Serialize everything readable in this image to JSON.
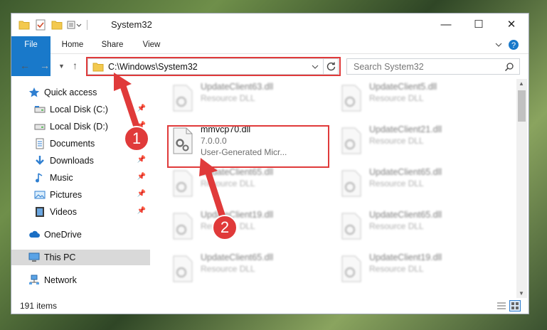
{
  "window": {
    "title": "System32",
    "controls": {
      "minimize": "—",
      "maximize": "☐",
      "close": "✕"
    }
  },
  "ribbon": {
    "tabs": [
      {
        "label": "File"
      },
      {
        "label": "Home"
      },
      {
        "label": "Share"
      },
      {
        "label": "View"
      }
    ],
    "expand_icon": "chevron-down-icon",
    "help_icon": "help-icon"
  },
  "navigation": {
    "address": "C:\\Windows\\System32",
    "search_placeholder": "Search System32"
  },
  "sidebar": {
    "items": [
      {
        "label": "Quick access",
        "icon": "star-icon"
      },
      {
        "label": "Local Disk (C:)",
        "icon": "drive-icon"
      },
      {
        "label": "Local Disk (D:)",
        "icon": "drive-icon"
      },
      {
        "label": "Documents",
        "icon": "documents-icon"
      },
      {
        "label": "Downloads",
        "icon": "download-icon"
      },
      {
        "label": "Music",
        "icon": "music-icon"
      },
      {
        "label": "Pictures",
        "icon": "pictures-icon"
      },
      {
        "label": "Videos",
        "icon": "videos-icon"
      },
      {
        "label": "OneDrive",
        "icon": "cloud-icon"
      },
      {
        "label": "This PC",
        "icon": "computer-icon"
      },
      {
        "label": "Network",
        "icon": "network-icon"
      }
    ]
  },
  "files": {
    "left": [
      {
        "name": "UpdateClient63.dll",
        "type": "Resource DLL"
      },
      {
        "name": "mmvcp70.dll",
        "version": "7.0.0.0",
        "company": "User-Generated Micr..."
      },
      {
        "name": "UpdateClient65.dll",
        "type": "Resource DLL"
      },
      {
        "name": "UpdateClient19.dll",
        "type": "Resource DLL"
      },
      {
        "name": "UpdateClient65.dll",
        "type": "Resource DLL"
      }
    ],
    "right": [
      {
        "name": "UpdateClient5.dll",
        "type": "Resource DLL"
      },
      {
        "name": "UpdateClient21.dll",
        "type": "Resource DLL"
      },
      {
        "name": "UpdateClient65.dll",
        "type": "Resource DLL"
      },
      {
        "name": "UpdateClient65.dll",
        "type": "Resource DLL"
      },
      {
        "name": "UpdateClient19.dll",
        "type": "Resource DLL"
      }
    ]
  },
  "status": {
    "items_count": "191 items"
  },
  "annotations": {
    "step1": "1",
    "step2": "2",
    "color": "#e03a3a"
  }
}
